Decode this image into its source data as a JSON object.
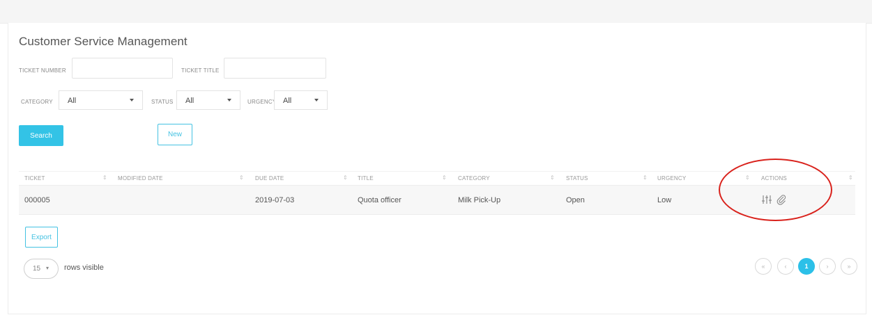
{
  "page": {
    "title": "Customer Service Management"
  },
  "filters": {
    "ticket_number_label": "TICKET NUMBER",
    "ticket_number_value": "",
    "ticket_title_label": "TICKET TITLE",
    "ticket_title_value": "",
    "category_label": "CATEGORY",
    "category_value": "All",
    "status_label": "STATUS",
    "status_value": "All",
    "urgency_label": "URGENCY",
    "urgency_value": "All"
  },
  "buttons": {
    "search": "Search",
    "new": "New",
    "export": "Export"
  },
  "table": {
    "columns": [
      "TICKET",
      "MODIFIED DATE",
      "DUE DATE",
      "TITLE",
      "CATEGORY",
      "STATUS",
      "URGENCY",
      "ACTIONS"
    ],
    "rows": [
      {
        "ticket": "000005",
        "modified_date": "",
        "due_date": "2019-07-03",
        "title": "Quota officer",
        "category": "Milk Pick-Up",
        "status": "Open",
        "urgency": "Low",
        "actions": [
          "adjust-icon",
          "attachment-icon"
        ]
      }
    ]
  },
  "footer": {
    "rows_per_page": "15",
    "rows_visible_label": "rows visible",
    "pagination": {
      "first": "«",
      "prev": "‹",
      "current_page": "1",
      "next": "›",
      "last": "»"
    }
  },
  "colors": {
    "primary": "#33c3e6",
    "annotation_ring": "#d9221c"
  }
}
